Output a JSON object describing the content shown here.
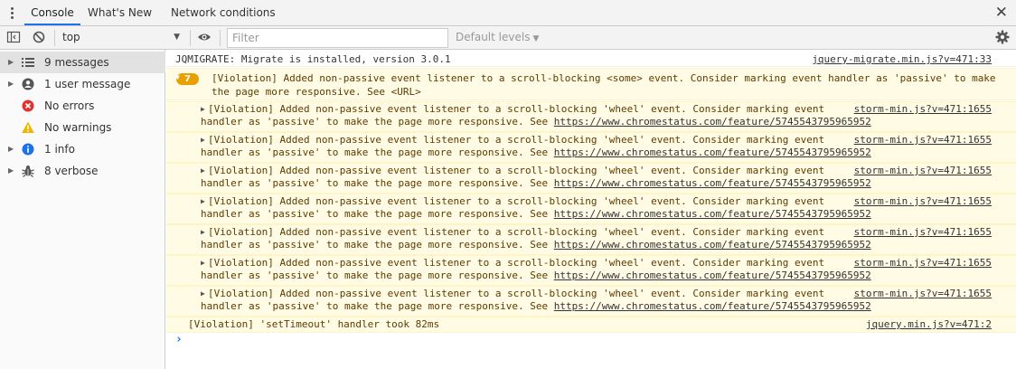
{
  "tabs": [
    {
      "label": "Console",
      "active": true
    },
    {
      "label": "What's New",
      "active": false
    },
    {
      "label": "Network conditions",
      "active": false
    }
  ],
  "toolbar": {
    "context": "top",
    "filter_placeholder": "Filter",
    "levels_label": "Default levels"
  },
  "sidebar": {
    "items": [
      {
        "label": "9 messages",
        "icon": "list-icon"
      },
      {
        "label": "1 user message",
        "icon": "user-icon"
      },
      {
        "label": "No errors",
        "icon": "error-icon"
      },
      {
        "label": "No warnings",
        "icon": "warning-icon"
      },
      {
        "label": "1 info",
        "icon": "info-icon"
      },
      {
        "label": "8 verbose",
        "icon": "bug-icon"
      }
    ]
  },
  "console": {
    "migrate": {
      "text": "JQMIGRATE: Migrate is installed, version 3.0.1",
      "link": "jquery-migrate.min.js?v=471:33"
    },
    "group": {
      "count": "7",
      "text_line1": "[Violation] Added non-passive event listener to a scroll-blocking <some> event. Consider marking event handler as 'passive' to make",
      "text_line2": "the page more responsive. See <URL>"
    },
    "violation": {
      "line1": "[Violation] Added non-passive event listener to a scroll-blocking 'wheel' event. Consider marking event",
      "line2_prefix": "handler as 'passive' to make the page more responsive. See ",
      "url": "https://www.chromestatus.com/feature/5745543795965952",
      "link": "storm-min.js?v=471:1655"
    },
    "timeout": {
      "text": "[Violation] 'setTimeout' handler took 82ms",
      "link": "jquery.min.js?v=471:2"
    }
  },
  "colors": {
    "accent": "#1a73e8",
    "warning_bg": "#fffbe5",
    "warning_text": "#5c3c00",
    "badge": "#e8a000"
  }
}
